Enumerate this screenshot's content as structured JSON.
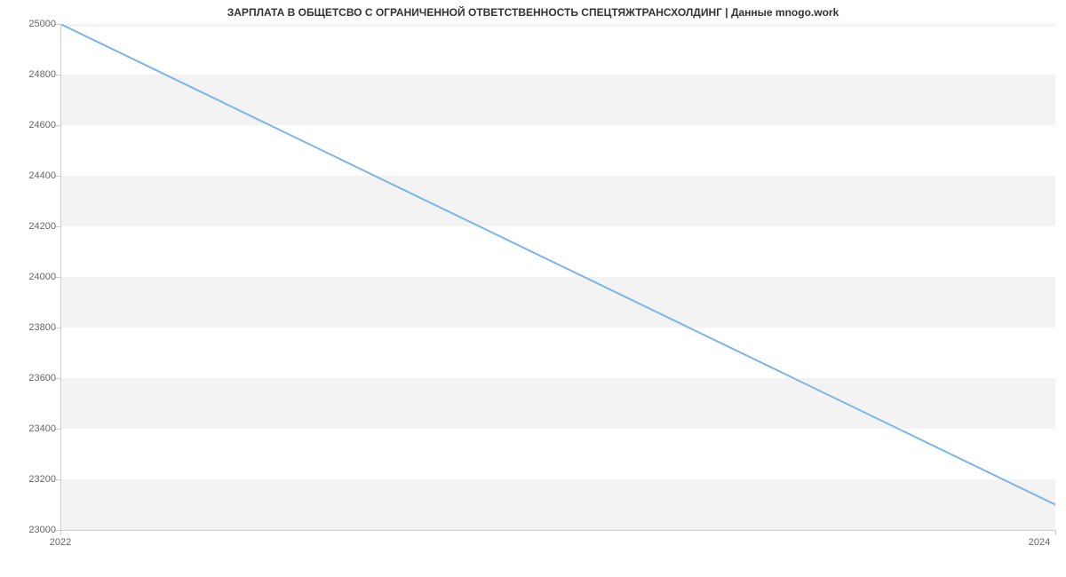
{
  "chart_data": {
    "type": "line",
    "title": "ЗАРПЛАТА В ОБЩЕТСВО С ОГРАНИЧЕННОЙ ОТВЕТСТВЕННОСТЬ СПЕЦТЯЖТРАНСХОЛДИНГ | Данные mnogo.work",
    "x": [
      2022,
      2024
    ],
    "values": [
      25000,
      23100
    ],
    "xlabel": "",
    "ylabel": "",
    "x_ticks": [
      2022,
      2024
    ],
    "y_ticks": [
      23000,
      23200,
      23400,
      23600,
      23800,
      24000,
      24200,
      24400,
      24600,
      24800,
      25000
    ],
    "xlim": [
      2022,
      2024
    ],
    "ylim": [
      23000,
      25000
    ],
    "line_color": "#7cb5ec"
  }
}
